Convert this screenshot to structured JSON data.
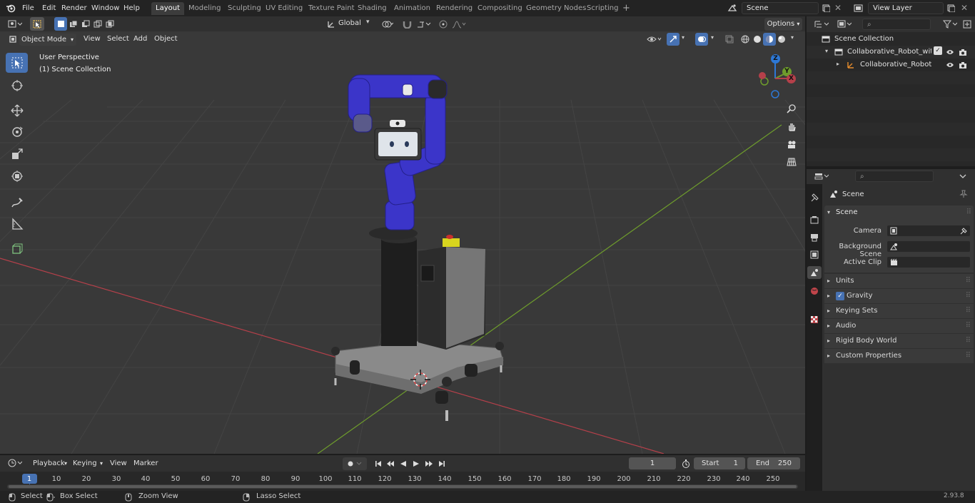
{
  "topbar": {
    "menus": [
      "File",
      "Edit",
      "Render",
      "Window",
      "Help"
    ],
    "workspaces": [
      "Layout",
      "Modeling",
      "Sculpting",
      "UV Editing",
      "Texture Paint",
      "Shading",
      "Animation",
      "Rendering",
      "Compositing",
      "Geometry Nodes",
      "Scripting"
    ],
    "add_tab": "+",
    "scene_name": "Scene",
    "view_layer": "View Layer"
  },
  "viewport_header": {
    "mode": "Object Mode",
    "menus": [
      "View",
      "Select",
      "Add",
      "Object"
    ],
    "transform_orientation": "Global",
    "options": "Options"
  },
  "viewport": {
    "overlay_line1": "User Perspective",
    "overlay_line2": "(1) Scene Collection",
    "gizmo": {
      "z": "Z",
      "y": "Y",
      "x": "X"
    }
  },
  "outliner": {
    "root": "Scene Collection",
    "items": [
      "Collaborative_Robot_with_Mc",
      "Collaborative_Robot_witl"
    ]
  },
  "properties": {
    "header": "Scene",
    "panel_title": "Scene",
    "camera_label": "Camera",
    "background_scene_label": "Background Scene",
    "active_clip_label": "Active Clip",
    "sections": [
      "Units",
      "Gravity",
      "Keying Sets",
      "Audio",
      "Rigid Body World",
      "Custom Properties"
    ],
    "gravity_checked": true
  },
  "timeline": {
    "menus": [
      "Playback",
      "Keying",
      "View",
      "Marker"
    ],
    "current_frame": "1",
    "start_label": "Start",
    "start": "1",
    "end_label": "End",
    "end": "250",
    "ruler": [
      "1",
      "10",
      "20",
      "30",
      "40",
      "50",
      "60",
      "70",
      "80",
      "90",
      "100",
      "110",
      "120",
      "130",
      "140",
      "150",
      "160",
      "170",
      "180",
      "190",
      "200",
      "210",
      "220",
      "230",
      "240",
      "250"
    ]
  },
  "statusbar": {
    "select": "Select",
    "box_select": "Box Select",
    "zoom_view": "Zoom View",
    "lasso_select": "Lasso Select",
    "version": "2.93.8"
  },
  "colors": {
    "accent": "#4772b3",
    "robot_arm": "#3b35c9",
    "x_axis": "#b5404a",
    "y_axis": "#6e9c2c",
    "z_axis": "#2d78d6"
  }
}
